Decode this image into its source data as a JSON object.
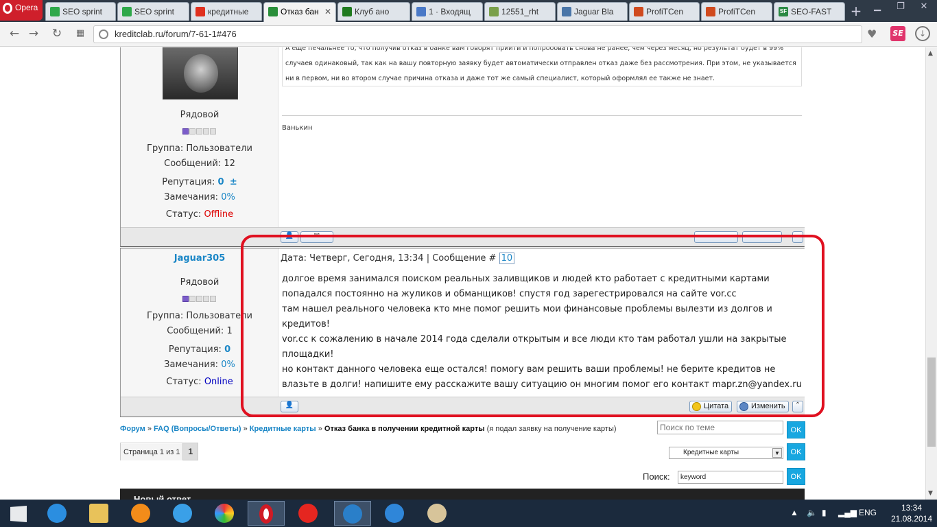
{
  "browser": {
    "name": "Opera",
    "tabs": [
      {
        "label": "SEO sprint",
        "color": "#2ea84a"
      },
      {
        "label": "SEO sprint",
        "color": "#2ea84a"
      },
      {
        "label": "кредитные",
        "color": "#e0301e"
      },
      {
        "label": "Отказ бан",
        "color": "#2a8f3a"
      },
      {
        "label": "Клуб ано",
        "color": "#1f7a1f"
      },
      {
        "label": "1 · Входящ",
        "color": "#4a79c7"
      },
      {
        "label": "12551_rht",
        "color": "#7aa04a"
      },
      {
        "label": "Jaguar Bla",
        "color": "#4a76a8"
      },
      {
        "label": "ProfiTCen",
        "color": "#d04a1e"
      },
      {
        "label": "ProfiTCen",
        "color": "#d04a1e"
      },
      {
        "label": "SEO-FAST",
        "color": "#2c8a45",
        "badge": "SF"
      }
    ],
    "url": "kreditclab.ru/forum/7-61-1#476",
    "se_badge": "SE"
  },
  "post_prev": {
    "text_lines": [
      "А еще печальнее то, что получив отказ в банке вам говорят прийти и попробовать снова не ранее, чем через месяц, но результат будет в 99%",
      "случаев одинаковый, так как на вашу повторную заявку будет автоматически отправлен отказ даже без рассмотрения. При этом, не указывается",
      "ни в первом, ни во втором случае причина отказа и даже тот же самый специалист, который оформлял ее также не знает."
    ],
    "signature": "Ванькин",
    "user": {
      "rank": "Рядовой",
      "group_label": "Группа:",
      "group_value": "Пользователи",
      "messages_label": "Сообщений:",
      "messages_value": "12",
      "reputation_label": "Репутация:",
      "reputation_value": "0",
      "reputation_extra": "±",
      "warnings_label": "Замечания:",
      "warnings_value": "0%",
      "status_label": "Статус:",
      "status_value": "Offline",
      "stars": 1
    }
  },
  "post": {
    "username": "Jaguar305",
    "header": "Дата: Четверг, Сегодня, 13:34 | Сообщение #",
    "number": "10",
    "text_lines": [
      "долгое время занимался поиском реальных заливщиков и людей кто работает с кредитными картами",
      "попадался постоянно на жуликов и обманщиков! спустя год зарегестрировался на сайте vor.cc",
      "там нашел реального человека кто мне помог решить мои финансовые проблемы вылезти из долгов и",
      "кредитов!",
      "vor.cc к сожалению в начале 2014 года сделали открытым и все люди кто там работал ушли на закрытые",
      "площадки!",
      "но контакт данного человека еще остался! помогу вам решить ваши проблемы! не берите кредитов не",
      "влазьте в долги! напишите ему расскажите вашу ситуацию он многим помог его контакт mapr.zn@yandex.ru"
    ],
    "user": {
      "rank": "Рядовой",
      "group_label": "Группа:",
      "group_value": "Пользователи",
      "messages_label": "Сообщений:",
      "messages_value": "1",
      "reputation_label": "Репутация:",
      "reputation_value": "0",
      "warnings_label": "Замечания:",
      "warnings_value": "0%",
      "status_label": "Статус:",
      "status_value": "Online",
      "stars": 1
    },
    "quote_label": "Цитата",
    "edit_label": "Изменить"
  },
  "breadcrumb": {
    "items": [
      "Форум",
      "FAQ (Вопросы/Ответы)",
      "Кредитные карты"
    ],
    "sep": "»",
    "current": "Отказ банка в получении кредитной карты",
    "note": "(я подал заявку на получение карты)"
  },
  "controls": {
    "topic_search_placeholder": "Поиск по теме",
    "ok_label": "OK",
    "pager_label": "Страница 1 из 1",
    "pager_current": "1",
    "forum_select_value": "Кредитные карты",
    "search_label": "Поиск:",
    "search_value": "keyword"
  },
  "footer": {
    "title": "Новый ответ"
  },
  "taskbar": {
    "lang": "ENG",
    "time": "13:34",
    "date": "21.08.2014"
  },
  "colors": {
    "highlight": "#e01020",
    "link": "#1a86c6",
    "offline": "#dd0000",
    "online": "#0000c0"
  }
}
